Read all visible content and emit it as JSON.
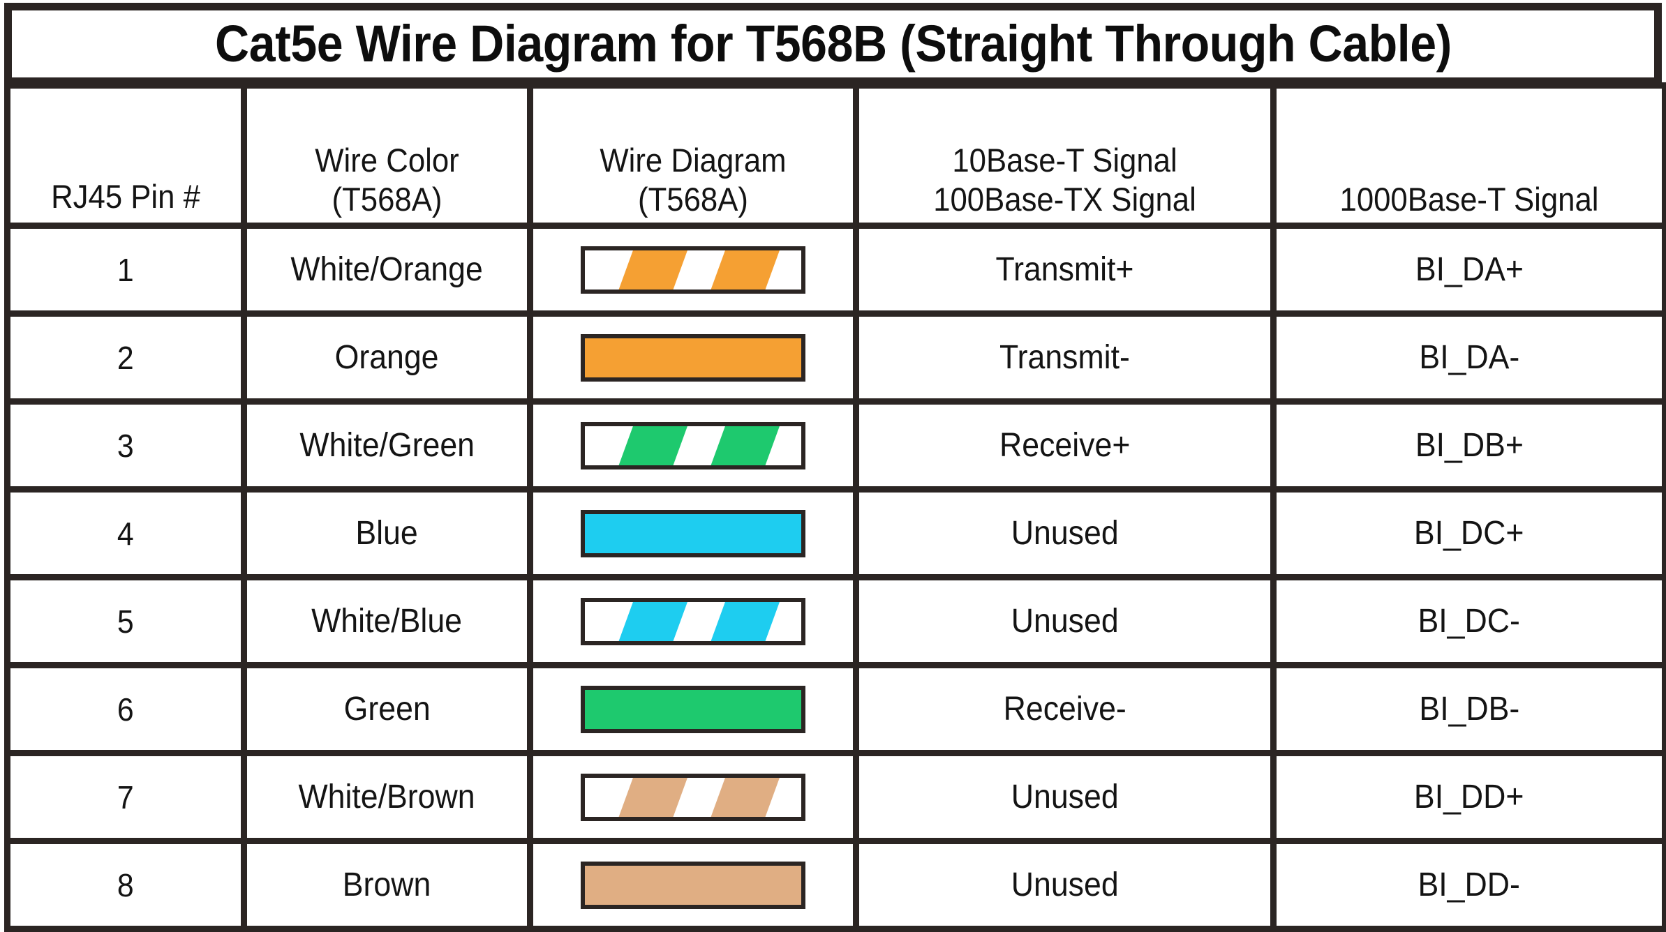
{
  "title": "Cat5e Wire Diagram for T568B (Straight Through Cable)",
  "colors": {
    "border": "#2b2523",
    "orange": "#f5a033",
    "green": "#1ec96e",
    "blue": "#1ecdf0",
    "brown": "#e0ae83",
    "white": "#ffffff"
  },
  "table": {
    "headers": [
      {
        "line1": "RJ45 Pin #",
        "line2": ""
      },
      {
        "line1": "Wire Color",
        "line2": "(T568A)"
      },
      {
        "line1": "Wire Diagram",
        "line2": "(T568A)"
      },
      {
        "line1": "10Base-T Signal",
        "line2": "100Base-TX Signal"
      },
      {
        "line1": "1000Base-T Signal",
        "line2": ""
      }
    ],
    "rows": [
      {
        "pin": "1",
        "wire_color": "White/Orange",
        "diagram": {
          "style": "striped",
          "base": "#ffffff",
          "stripe": "#f5a033"
        },
        "signal_10_100": "Transmit+",
        "signal_1000": "BI_DA+"
      },
      {
        "pin": "2",
        "wire_color": "Orange",
        "diagram": {
          "style": "solid",
          "base": "#f5a033",
          "stripe": ""
        },
        "signal_10_100": "Transmit-",
        "signal_1000": "BI_DA-"
      },
      {
        "pin": "3",
        "wire_color": "White/Green",
        "diagram": {
          "style": "striped",
          "base": "#ffffff",
          "stripe": "#1ec96e"
        },
        "signal_10_100": "Receive+",
        "signal_1000": "BI_DB+"
      },
      {
        "pin": "4",
        "wire_color": "Blue",
        "diagram": {
          "style": "solid",
          "base": "#1ecdf0",
          "stripe": ""
        },
        "signal_10_100": "Unused",
        "signal_1000": "BI_DC+"
      },
      {
        "pin": "5",
        "wire_color": "White/Blue",
        "diagram": {
          "style": "striped",
          "base": "#ffffff",
          "stripe": "#1ecdf0"
        },
        "signal_10_100": "Unused",
        "signal_1000": "BI_DC-"
      },
      {
        "pin": "6",
        "wire_color": "Green",
        "diagram": {
          "style": "solid",
          "base": "#1ec96e",
          "stripe": ""
        },
        "signal_10_100": "Receive-",
        "signal_1000": "BI_DB-"
      },
      {
        "pin": "7",
        "wire_color": "White/Brown",
        "diagram": {
          "style": "striped",
          "base": "#ffffff",
          "stripe": "#e0ae83"
        },
        "signal_10_100": "Unused",
        "signal_1000": "BI_DD+"
      },
      {
        "pin": "8",
        "wire_color": "Brown",
        "diagram": {
          "style": "solid",
          "base": "#e0ae83",
          "stripe": ""
        },
        "signal_10_100": "Unused",
        "signal_1000": "BI_DD-"
      }
    ]
  }
}
